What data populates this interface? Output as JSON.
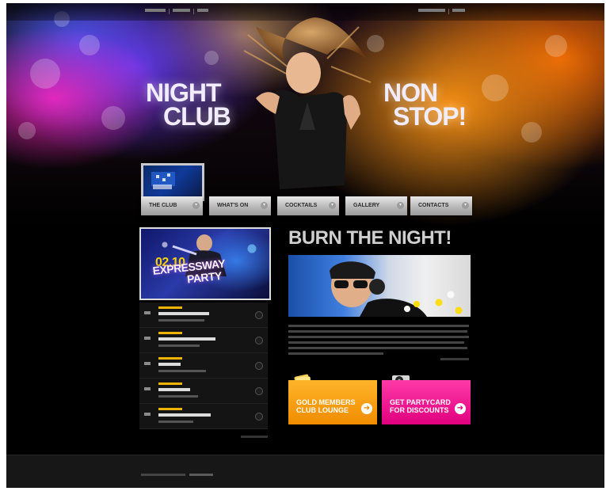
{
  "hero": {
    "title_left": [
      "NIGHT",
      "CLUB"
    ],
    "title_right": [
      "NON",
      "STOP!"
    ]
  },
  "nav": {
    "items": [
      {
        "label": "THE CLUB"
      },
      {
        "label": "WHAT'S ON"
      },
      {
        "label": "COCKTAILS"
      },
      {
        "label": "GALLERY"
      },
      {
        "label": "CONTACTS"
      }
    ]
  },
  "promo": {
    "date": "02.10",
    "title_line1": "EXPRESSWAY",
    "title_line2": "PARTY"
  },
  "main": {
    "headline": "BURN THE NIGHT!"
  },
  "cta": {
    "gold_line1": "GOLD MEMBERS",
    "gold_line2": "CLUB LOUNGE",
    "party_line1": "GET PARTYCARD",
    "party_line2": "FOR DISCOUNTS"
  },
  "colors": {
    "accent_gold": "#f08c00",
    "accent_pink": "#e0007e",
    "event_date": "#f0b400"
  }
}
